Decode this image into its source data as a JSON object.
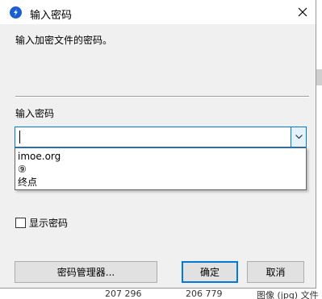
{
  "dialog": {
    "title": "输入密码",
    "message": "输入加密文件的密码。",
    "field_label": "输入密码",
    "password_value": "",
    "dropdown_items": [
      "imoe.org",
      "⑨",
      "终点"
    ],
    "show_password_label": "显示密码",
    "show_password_checked": false,
    "buttons": {
      "manager": "密码管理器...",
      "ok": "确定",
      "cancel": "取消"
    }
  },
  "background": {
    "row_values": [
      "207 296",
      "206 779",
      "图像 (jpg) 文件"
    ]
  },
  "icons": {
    "app": "app-logo-icon",
    "close": "close-icon",
    "dropdown": "chevron-down-icon"
  },
  "colors": {
    "accent": "#0078d7",
    "dialog_bg": "#f0f0f0",
    "app_icon": "#1a5fd0"
  }
}
